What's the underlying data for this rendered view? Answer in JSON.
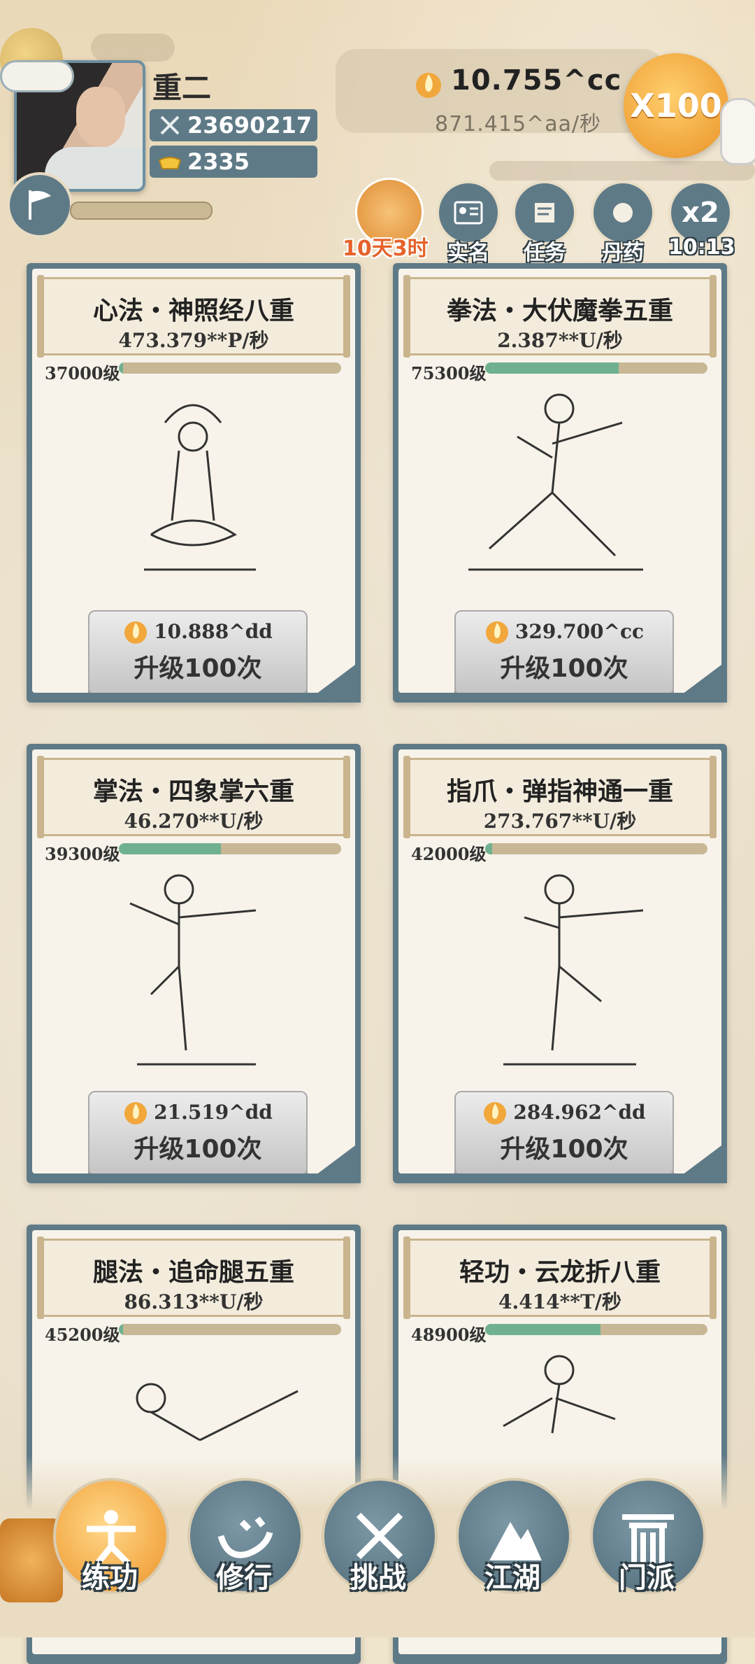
{
  "player": {
    "name": "重二",
    "power": "23690217",
    "gold_ingots": "2335"
  },
  "currency": {
    "amount": "10.755^cc",
    "rate": "871.415^aa/秒",
    "multiplier_label": "X100"
  },
  "features": [
    {
      "id": "mooncake",
      "label": "10天3时"
    },
    {
      "id": "real-name",
      "label": "实名"
    },
    {
      "id": "tasks",
      "label": "任务"
    },
    {
      "id": "elixir",
      "label": "丹药"
    },
    {
      "id": "double",
      "icon_text": "x2",
      "label": "10:13"
    }
  ],
  "skills": [
    {
      "title": "心法・神照经八重",
      "rate": "473.379**P/秒",
      "level": "37000级",
      "level_progress": 0.02,
      "cost": "10.888^dd",
      "upgrade": "升级100次"
    },
    {
      "title": "拳法・大伏魔拳五重",
      "rate": "2.387**U/秒",
      "level": "75300级",
      "level_progress": 0.6,
      "cost": "329.700^cc",
      "upgrade": "升级100次"
    },
    {
      "title": "掌法・四象掌六重",
      "rate": "46.270**U/秒",
      "level": "39300级",
      "level_progress": 0.46,
      "cost": "21.519^dd",
      "upgrade": "升级100次"
    },
    {
      "title": "指爪・弹指神通一重",
      "rate": "273.767**U/秒",
      "level": "42000级",
      "level_progress": 0.03,
      "cost": "284.962^dd",
      "upgrade": "升级100次"
    },
    {
      "title": "腿法・追命腿五重",
      "rate": "86.313**U/秒",
      "level": "45200级",
      "level_progress": 0.02,
      "cost": "",
      "upgrade": ""
    },
    {
      "title": "轻功・云龙折八重",
      "rate": "4.414**T/秒",
      "level": "48900级",
      "level_progress": 0.52,
      "cost": "",
      "upgrade": ""
    }
  ],
  "nav": [
    {
      "id": "practice",
      "label": "练功",
      "active": true
    },
    {
      "id": "cultivate",
      "label": "修行",
      "active": false
    },
    {
      "id": "challenge",
      "label": "挑战",
      "active": false
    },
    {
      "id": "jianghu",
      "label": "江湖",
      "active": false
    },
    {
      "id": "sect",
      "label": "门派",
      "active": false
    }
  ],
  "colors": {
    "panel": "#5f7a87",
    "accent_orange": "#f0a43b",
    "progress_green": "#6fb18f",
    "background": "#efe4cc"
  }
}
